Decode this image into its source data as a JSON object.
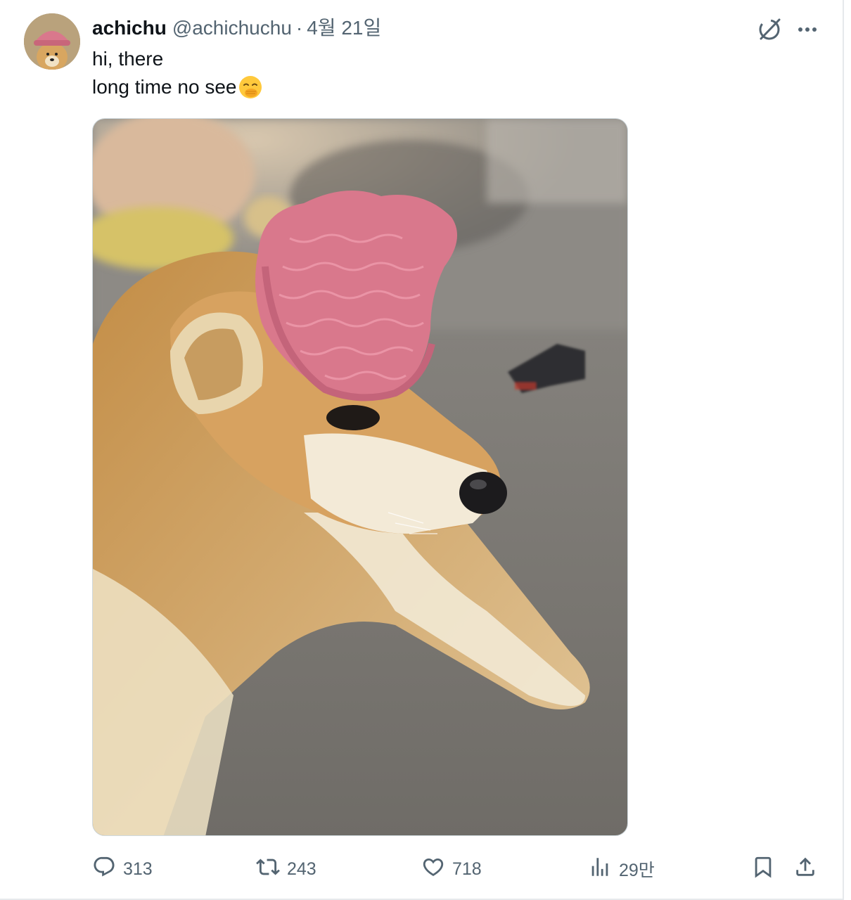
{
  "post": {
    "author": {
      "display_name": "achichu",
      "handle": "@achichuchu",
      "separator": "·",
      "date": "4월 21일",
      "avatar_icon": "avatar-dog-in-pink-hat"
    },
    "text": {
      "line1": "hi, there",
      "line2": "long time no see",
      "emoji": "face-with-hand-over-mouth"
    },
    "media": {
      "kind": "photo",
      "subject": "shiba-dog-wearing-pink-knit-hat"
    },
    "actions": {
      "replies": "313",
      "reposts": "243",
      "likes": "718",
      "views": "29만"
    }
  },
  "icons": {
    "grok": "grok-icon",
    "more": "more-icon",
    "reply": "reply-icon",
    "repost": "repost-icon",
    "like": "like-icon",
    "views": "views-icon",
    "bookmark": "bookmark-icon",
    "share": "share-icon"
  },
  "colors": {
    "text_primary": "#0f1419",
    "text_secondary": "#536471",
    "border": "#cfd9de",
    "hat_pink": "#d9788c"
  }
}
